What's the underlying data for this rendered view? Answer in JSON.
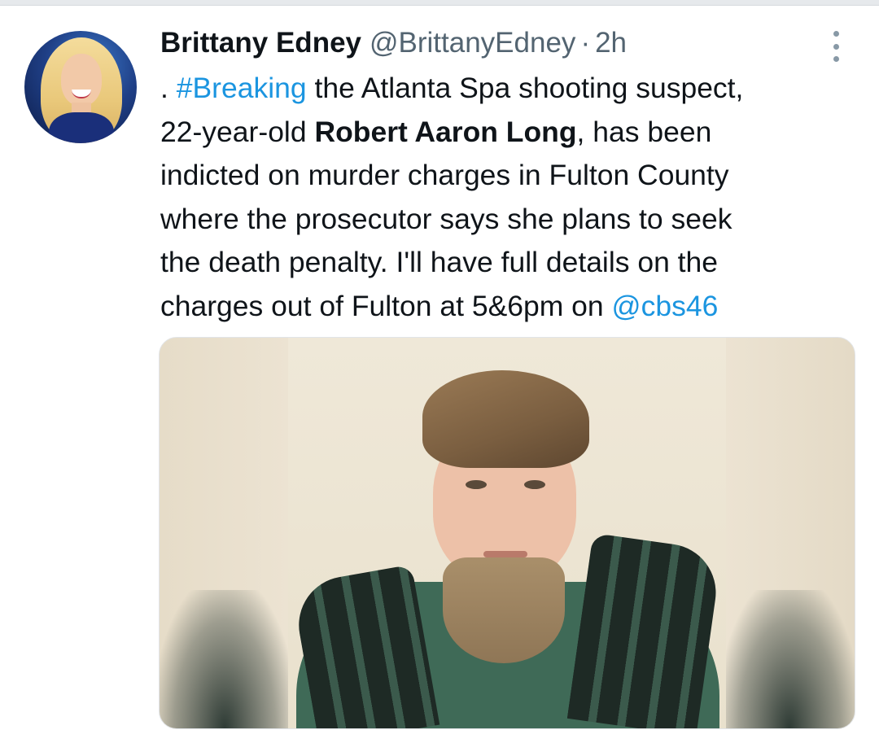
{
  "tweet": {
    "author": {
      "display_name": "Brittany Edney",
      "handle": "@BrittanyEdney",
      "separator": "·",
      "time": "2h"
    },
    "text": {
      "p1": ". ",
      "hashtag": "#Breaking",
      "p2": " the Atlanta Spa shooting suspect,\n22-year-old ",
      "bold_name": "Robert Aaron Long",
      "p3": ", has been\nindicted on murder charges in Fulton County\nwhere the prosecutor says she plans to seek\nthe death penalty. I'll have full details on the\ncharges out of Fulton at 5&6pm on ",
      "mention": "@cbs46"
    },
    "media": {
      "type": "photo"
    },
    "more_menu_icon": "more-vertical-icon"
  },
  "colors": {
    "link": "#1b95e0",
    "text": "#0f1419",
    "secondary": "#536471"
  }
}
